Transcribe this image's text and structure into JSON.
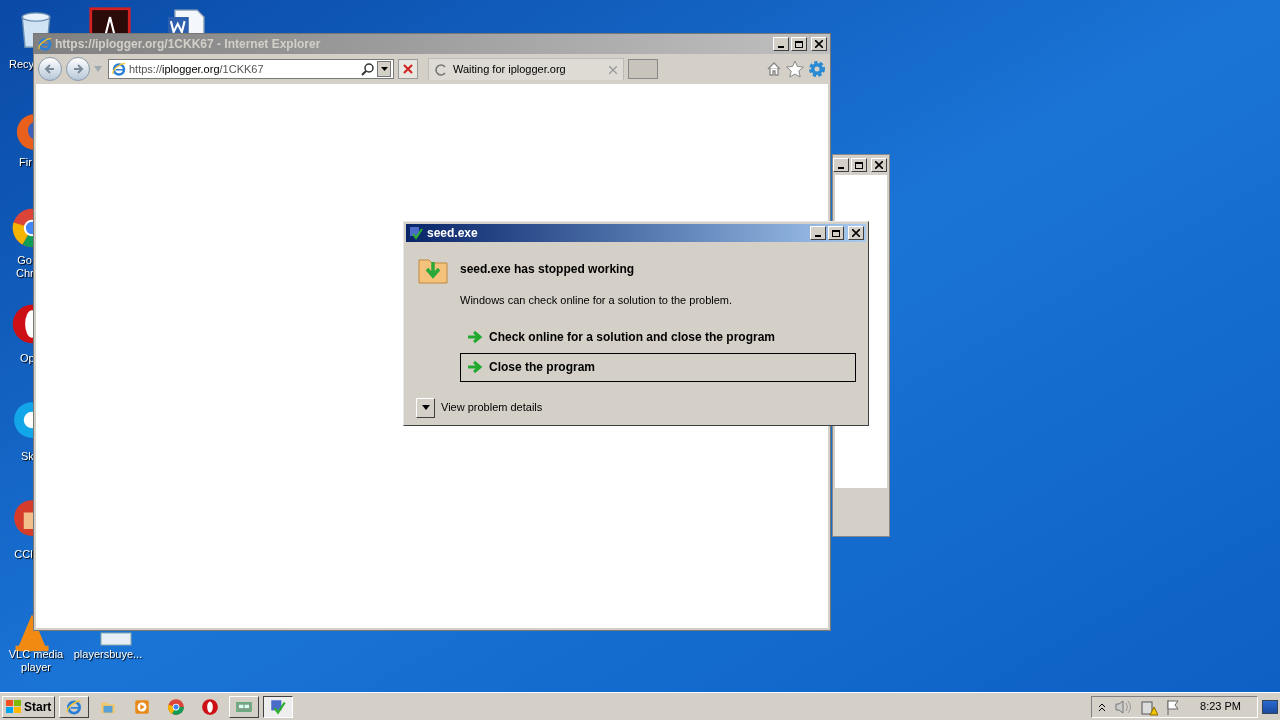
{
  "desktop_icons": [
    {
      "kind": "recycle",
      "label": "Recy"
    },
    {
      "kind": "pdf"
    },
    {
      "kind": "word"
    },
    {
      "kind": "firefox",
      "label": "Fir"
    },
    {
      "kind": "chrome",
      "label": "Go Chr"
    },
    {
      "kind": "opera",
      "label": "Op"
    },
    {
      "kind": "skype",
      "label": "Sk"
    },
    {
      "kind": "ccleaner",
      "label": "CCl"
    },
    {
      "kind": "vlc",
      "label": "VLC media player"
    },
    {
      "kind": "file",
      "label": "playersbuye..."
    }
  ],
  "browser": {
    "title": "https://iplogger.org/1CKK67 - Internet Explorer",
    "address": {
      "prefix": "https://",
      "domain": "iplogger.org",
      "path": "/1CKK67"
    },
    "tab": {
      "label": "Waiting for iplogger.org",
      "loading": true
    }
  },
  "dialog": {
    "title": "seed.exe",
    "heading": "seed.exe has stopped working",
    "message": "Windows can check online for a solution to the problem.",
    "options": [
      {
        "label": "Check online for a solution and close the program",
        "selected": false
      },
      {
        "label": "Close the program",
        "selected": true
      }
    ],
    "details": "View problem details"
  },
  "taskbar": {
    "start": "Start",
    "items": [
      {
        "kind": "ie",
        "selected": false
      },
      {
        "kind": "folder",
        "selected": false
      },
      {
        "kind": "media",
        "selected": false
      },
      {
        "kind": "chrome",
        "selected": false
      },
      {
        "kind": "opera",
        "selected": false
      },
      {
        "kind": "network",
        "selected": false
      },
      {
        "kind": "seed",
        "selected": true
      }
    ],
    "clock": "8:23 PM"
  }
}
